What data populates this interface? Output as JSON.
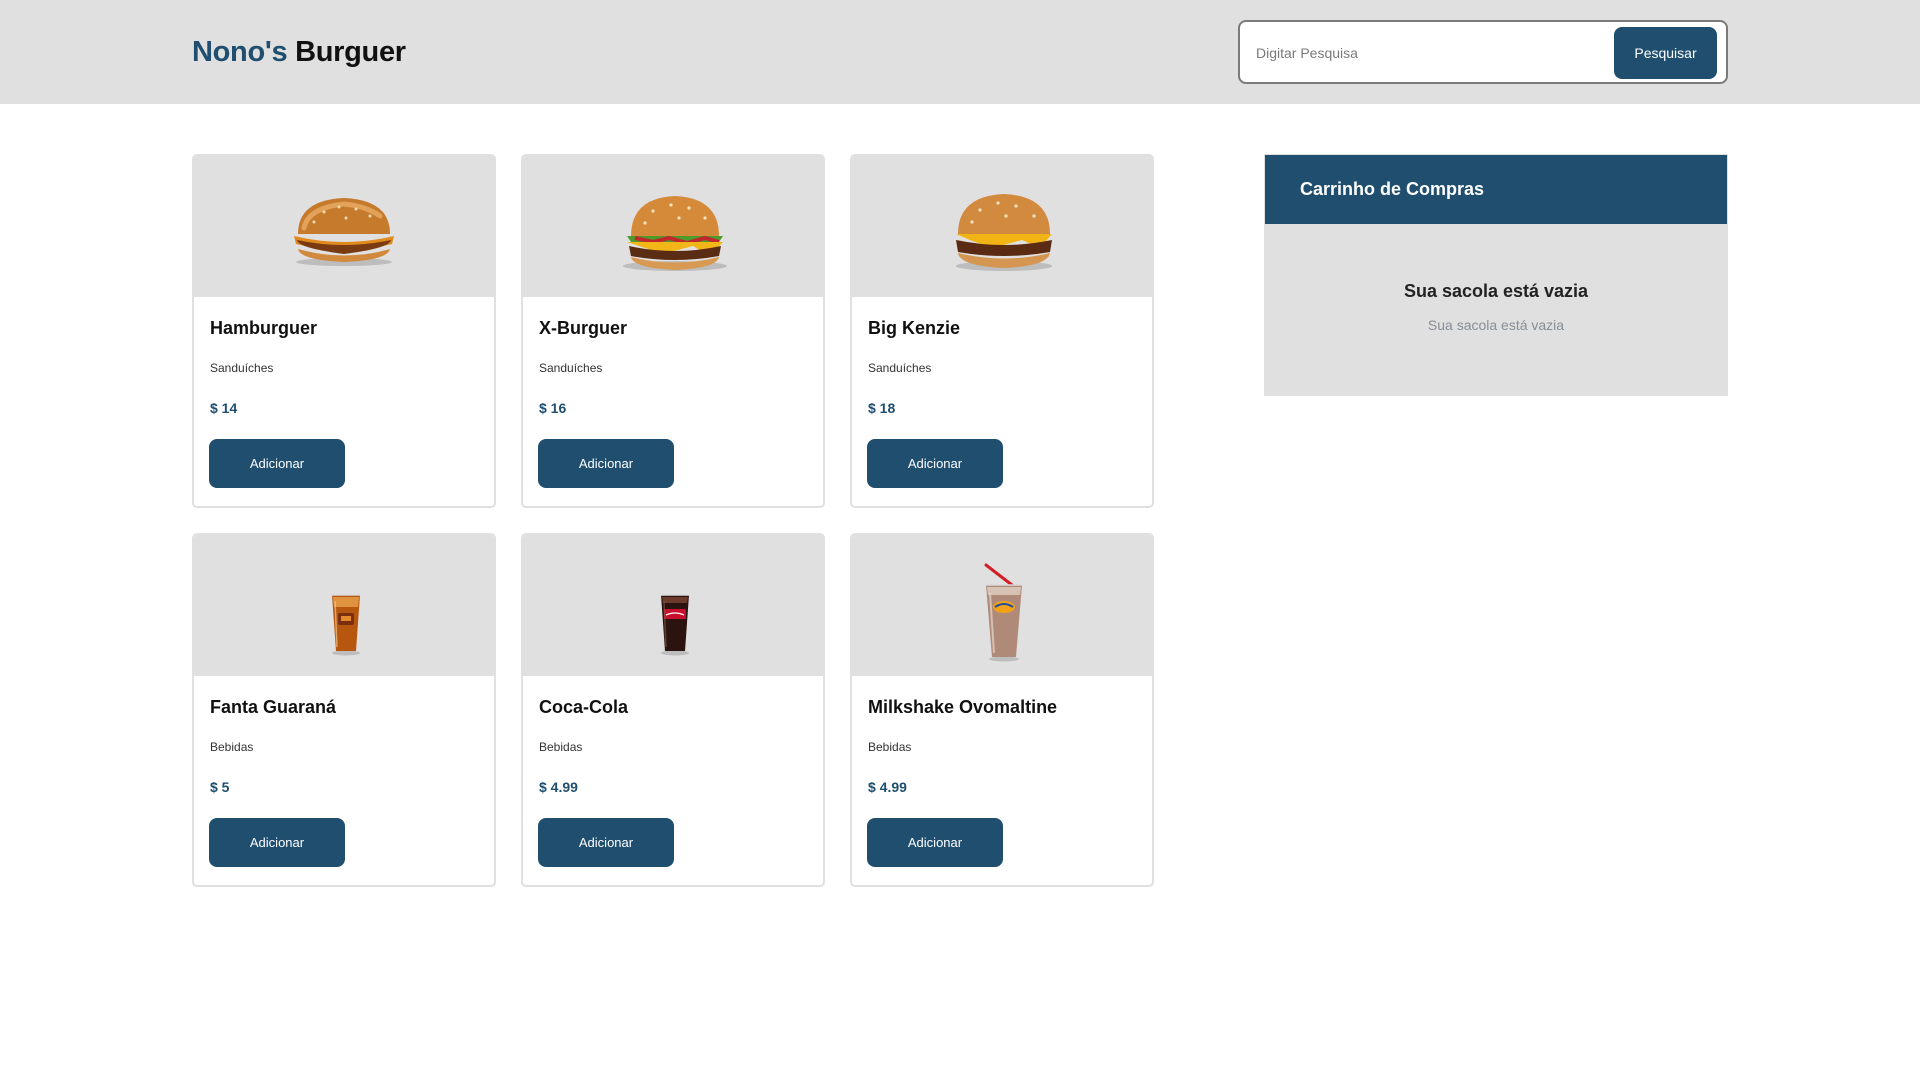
{
  "header": {
    "logo_part1": "Nono's",
    "logo_part2": "Burguer",
    "search": {
      "placeholder": "Digitar Pesquisa",
      "value": "",
      "button_label": "Pesquisar"
    }
  },
  "products": [
    {
      "name": "Hamburguer",
      "category": "Sanduíches",
      "price": "$ 14",
      "button_label": "Adicionar",
      "image_icon": "hamburger-image"
    },
    {
      "name": "X-Burguer",
      "category": "Sanduíches",
      "price": "$ 16",
      "button_label": "Adicionar",
      "image_icon": "cheeseburger-image"
    },
    {
      "name": "Big Kenzie",
      "category": "Sanduíches",
      "price": "$ 18",
      "button_label": "Adicionar",
      "image_icon": "double-burger-image"
    },
    {
      "name": "Fanta Guaraná",
      "category": "Bebidas",
      "price": "$ 5",
      "button_label": "Adicionar",
      "image_icon": "soda-glass-image"
    },
    {
      "name": "Coca-Cola",
      "category": "Bebidas",
      "price": "$ 4.99",
      "button_label": "Adicionar",
      "image_icon": "cola-glass-image"
    },
    {
      "name": "Milkshake Ovomaltine",
      "category": "Bebidas",
      "price": "$ 4.99",
      "button_label": "Adicionar",
      "image_icon": "milkshake-image"
    }
  ],
  "cart": {
    "title": "Carrinho de Compras",
    "empty_title": "Sua sacola está vazia",
    "empty_subtitle": "Sua sacola está vazia"
  },
  "colors": {
    "primary": "#1f4e6f",
    "header_bg": "#e0e0e0",
    "card_border": "#e0e0e0",
    "muted_text": "#868e96"
  }
}
